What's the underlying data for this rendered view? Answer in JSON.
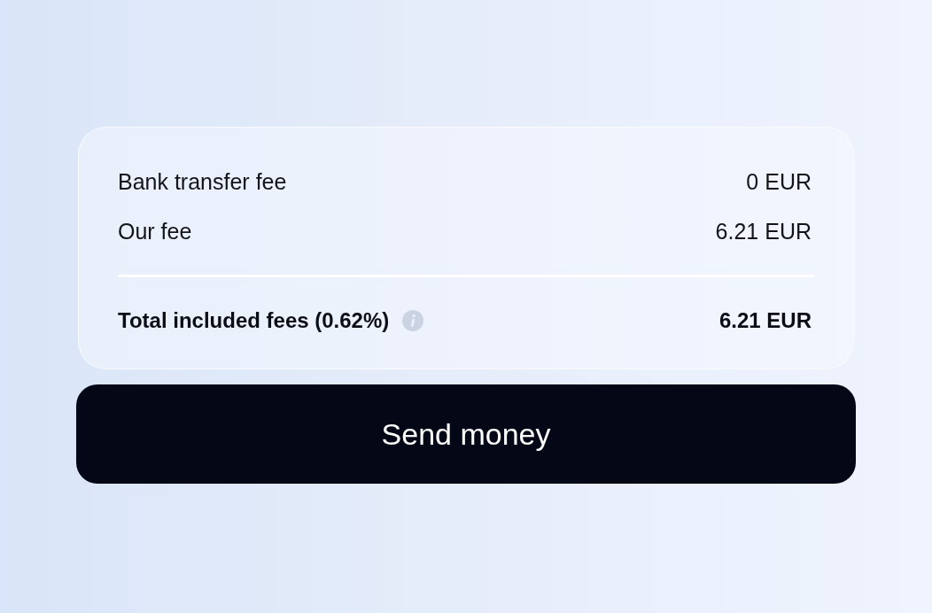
{
  "fees": [
    {
      "label": "Bank transfer fee",
      "amount": "0 EUR"
    },
    {
      "label": "Our fee",
      "amount": "6.21 EUR"
    }
  ],
  "total": {
    "label": "Total included fees (0.62%)",
    "amount": "6.21 EUR"
  },
  "button": {
    "label": "Send money"
  }
}
